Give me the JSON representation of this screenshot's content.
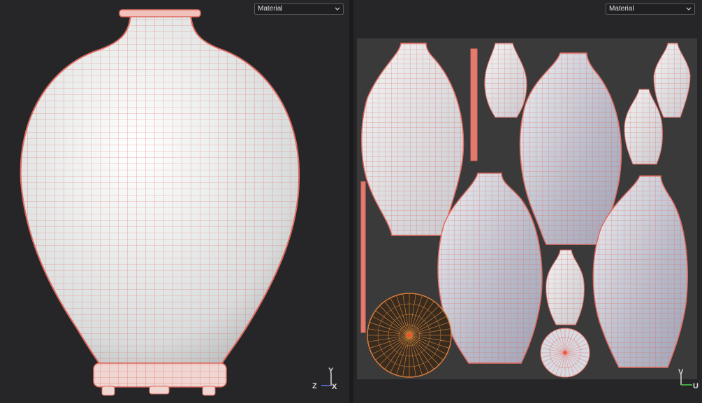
{
  "viewport_3d": {
    "shading_dropdown": {
      "value": "Material"
    },
    "gizmo": {
      "axis_y": "Y",
      "axis_z": "Z",
      "axis_x": "X",
      "y_color": "#d8d8d8",
      "z_color": "#5b7cf0",
      "x_color": "#e04848"
    }
  },
  "viewport_uv": {
    "shading_dropdown": {
      "value": "Material"
    },
    "gizmo": {
      "axis_v": "V",
      "axis_u": "U",
      "v_color": "#d8d8d8",
      "u_color": "#4ad04a"
    }
  },
  "colors": {
    "background": "#262629",
    "uv_canvas": "#3a3a3b",
    "wireframe": "#e06a60",
    "surface": "#ecefee"
  }
}
